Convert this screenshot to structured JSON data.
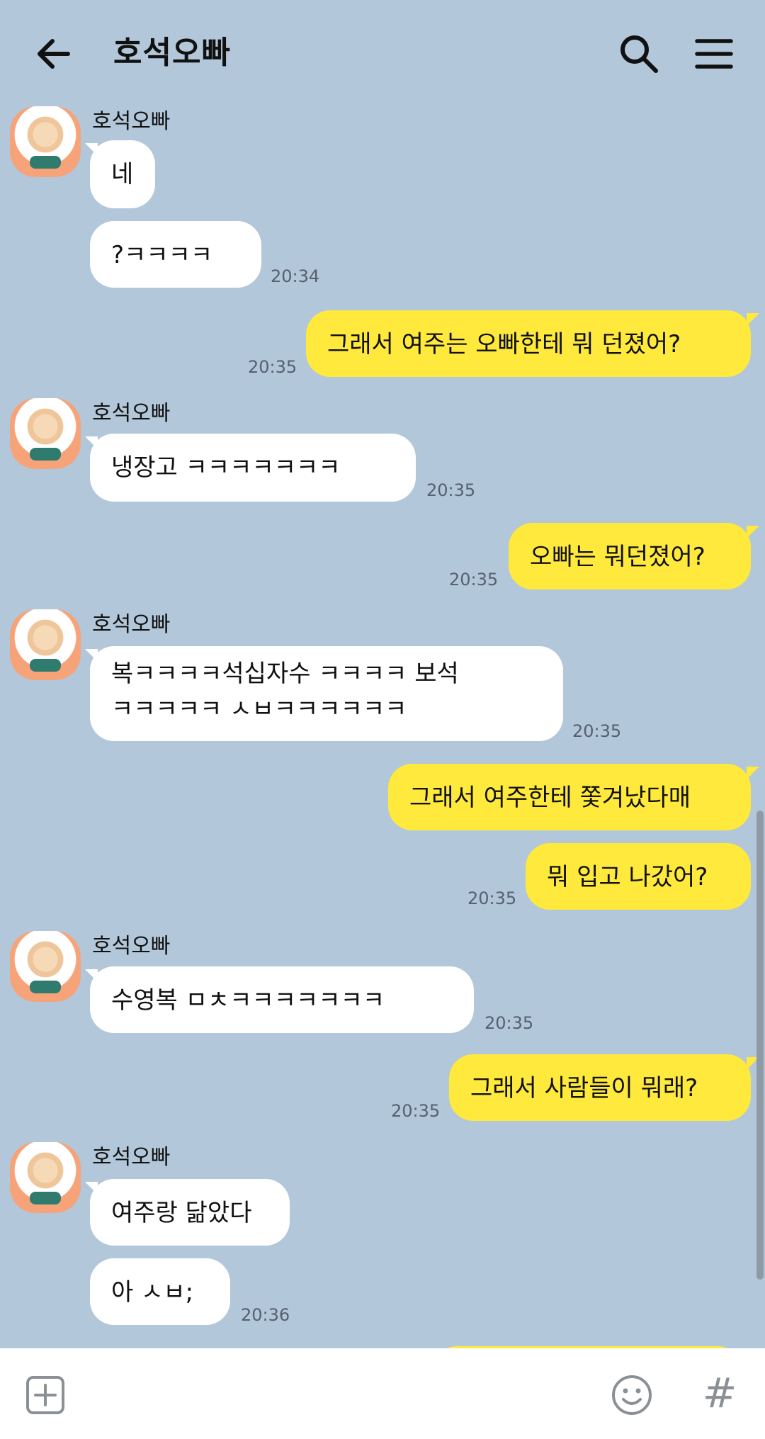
{
  "header": {
    "title": "호석오빠"
  },
  "messages": [
    {
      "sender": "호석오빠",
      "text": "네"
    },
    {
      "text": "?ㅋㅋㅋㅋ",
      "time": "20:34"
    },
    {
      "text": "그래서 여주는 오빠한테 뭐 던졌어?",
      "time": "20:35"
    },
    {
      "sender": "호석오빠",
      "text": "냉장고 ㅋㅋㅋㅋㅋㅋㅋ",
      "time": "20:35"
    },
    {
      "text": "오빠는 뭐던졌어?",
      "time": "20:35"
    },
    {
      "sender": "호석오빠",
      "line1": "복ㅋㅋㅋㅋ석십자수 ㅋㅋㅋㅋ 보석",
      "line2": "ㅋㅋㅋㅋㅋ ㅅㅂㅋㅋㅋㅋㅋㅋ",
      "time": "20:35"
    },
    {
      "text": "그래서 여주한테 쫓겨났다매"
    },
    {
      "text": "뭐 입고 나갔어?",
      "time": "20:35"
    },
    {
      "sender": "호석오빠",
      "text": "수영복 ㅁㅊㅋㅋㅋㅋㅋㅋㅋ",
      "time": "20:35"
    },
    {
      "text": "그래서 사람들이 뭐래?",
      "time": "20:35"
    },
    {
      "sender": "호석오빠",
      "text": "여주랑 닮았다"
    },
    {
      "text": "아 ㅅㅂ;",
      "time": "20:36"
    }
  ],
  "icons": {
    "back": "arrow-left-icon",
    "search": "search-icon",
    "menu": "hamburger-menu-icon",
    "attach": "plus-square-icon",
    "emoji": "smiley-icon",
    "hash": "#"
  },
  "colors": {
    "background": "#b2c7d9",
    "incoming": "#ffffff",
    "outgoing": "#fee93c"
  }
}
